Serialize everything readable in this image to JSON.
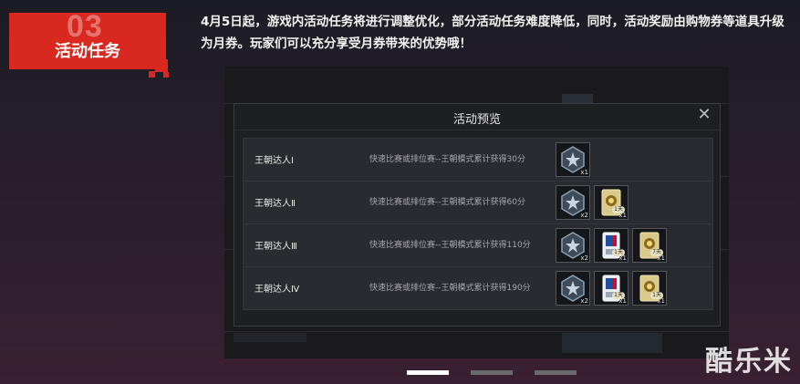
{
  "section": {
    "number": "03",
    "label": "活动任务"
  },
  "intro": {
    "text": "4月5日起，游戏内活动任务将进行调整优化，部分活动任务难度降低，同时，活动奖励由购物券等道具升级为月券。玩家们可以充分享受月券带来的优势哦！"
  },
  "dialog": {
    "title": "活动预览",
    "close_icon": "close-icon",
    "rows": [
      {
        "name": "王朝达人Ⅰ",
        "desc": "快速比赛或排位赛--王朝模式累计获得30分",
        "rewards": [
          {
            "icon": "ticket-star-icon",
            "qty": "x1"
          }
        ]
      },
      {
        "name": "王朝达人Ⅱ",
        "desc": "快速比赛或排位赛--王朝模式累计获得60分",
        "rewards": [
          {
            "icon": "ticket-star-icon",
            "qty": "x2"
          },
          {
            "icon": "gold-card-icon",
            "qty": "x1",
            "tag": "1天"
          }
        ]
      },
      {
        "name": "王朝达人Ⅲ",
        "desc": "快速比赛或排位赛--王朝模式累计获得110分",
        "rewards": [
          {
            "icon": "ticket-star-icon",
            "qty": "x2"
          },
          {
            "icon": "player-card-icon",
            "qty": "x1",
            "tag": "1天"
          },
          {
            "icon": "gold-card-icon",
            "qty": "x1",
            "tag": "7天"
          }
        ]
      },
      {
        "name": "王朝达人Ⅳ",
        "desc": "快速比赛或排位赛--王朝模式累计获得190分",
        "rewards": [
          {
            "icon": "ticket-star-icon",
            "qty": "x2"
          },
          {
            "icon": "player-card-icon",
            "qty": "x1",
            "tag": "1天"
          },
          {
            "icon": "gold-card-icon",
            "qty": "x1",
            "tag": "1天"
          }
        ]
      }
    ]
  },
  "carousel": {
    "active_index": 0,
    "count": 3
  },
  "watermark": "酷乐米",
  "colors": {
    "accent": "#d8281f",
    "dialog_bg": "#1e1f23",
    "row_bg": "#2a2b30"
  }
}
